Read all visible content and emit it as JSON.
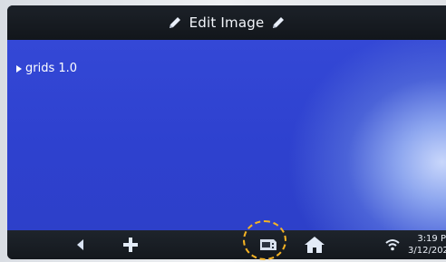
{
  "header": {
    "title": "Edit Image",
    "left_icon": "pencil-icon",
    "right_icon": "pencil-icon"
  },
  "main": {
    "tree": [
      {
        "label": "grids 1.0",
        "expanded": false
      }
    ]
  },
  "bottom_bar": {
    "buttons": [
      "back-arrow-icon",
      "add-icon",
      "sd-card-icon",
      "home-icon",
      "wifi-icon"
    ],
    "time": "3:19 P",
    "date": "3/12/202"
  },
  "colors": {
    "screen_blue": "#2E41CF",
    "bar_dark": "#161B21",
    "highlight": "#F5B324"
  }
}
